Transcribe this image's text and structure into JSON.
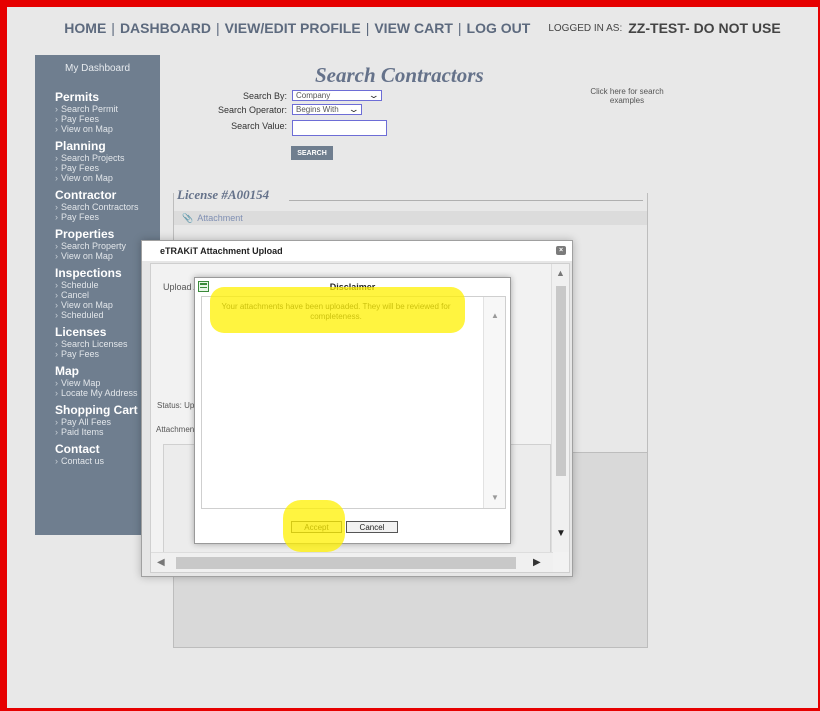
{
  "topnav": {
    "items": [
      "HOME",
      "DASHBOARD",
      "VIEW/EDIT PROFILE",
      "VIEW CART",
      "LOG OUT"
    ],
    "logged_in_label": "LOGGED IN AS:",
    "logged_in_user": "ZZ-TEST- DO NOT USE"
  },
  "sidebar": {
    "dashboard": "My Dashboard",
    "sections": [
      {
        "title": "Permits",
        "items": [
          "Search Permit",
          "Pay Fees",
          "View on Map"
        ]
      },
      {
        "title": "Planning",
        "items": [
          "Search Projects",
          "Pay Fees",
          "View on Map"
        ]
      },
      {
        "title": "Contractor",
        "items": [
          "Search Contractors",
          "Pay Fees"
        ]
      },
      {
        "title": "Properties",
        "items": [
          "Search Property",
          "View on Map"
        ]
      },
      {
        "title": "Inspections",
        "items": [
          "Schedule",
          "Cancel",
          "View on Map",
          "Scheduled"
        ]
      },
      {
        "title": "Licenses",
        "items": [
          "Search Licenses",
          "Pay Fees"
        ]
      },
      {
        "title": "Map",
        "items": [
          "View Map",
          "Locate My Address"
        ]
      },
      {
        "title": "Shopping Cart",
        "items": [
          "Pay All Fees",
          "Paid Items"
        ]
      },
      {
        "title": "Contact",
        "items": [
          "Contact us"
        ]
      }
    ]
  },
  "search": {
    "title": "Search Contractors",
    "search_by_label": "Search By:",
    "search_by_value": "Company",
    "operator_label": "Search Operator:",
    "operator_value": "Begins With",
    "value_label": "Search Value:",
    "value": "",
    "button": "SEARCH",
    "examples_link": "Click here for search examples"
  },
  "license": {
    "title": "License #A00154",
    "attachment_link": "Attachment"
  },
  "upload_modal": {
    "title": "eTRAKiT Attachment Upload",
    "upload_label": "Upload A",
    "status_label": "Status: Uplo",
    "attachments_label": "Attachments"
  },
  "disclaimer": {
    "title": "Disclaimer",
    "message": "Your attachments have been uploaded.  They will be reviewed for completeness.",
    "accept": "Accept",
    "cancel": "Cancel"
  },
  "colors": {
    "frame": "#e60000",
    "sidebar": "#6f7e8f",
    "title_text": "#65728a",
    "highlighter": "#fff000"
  }
}
